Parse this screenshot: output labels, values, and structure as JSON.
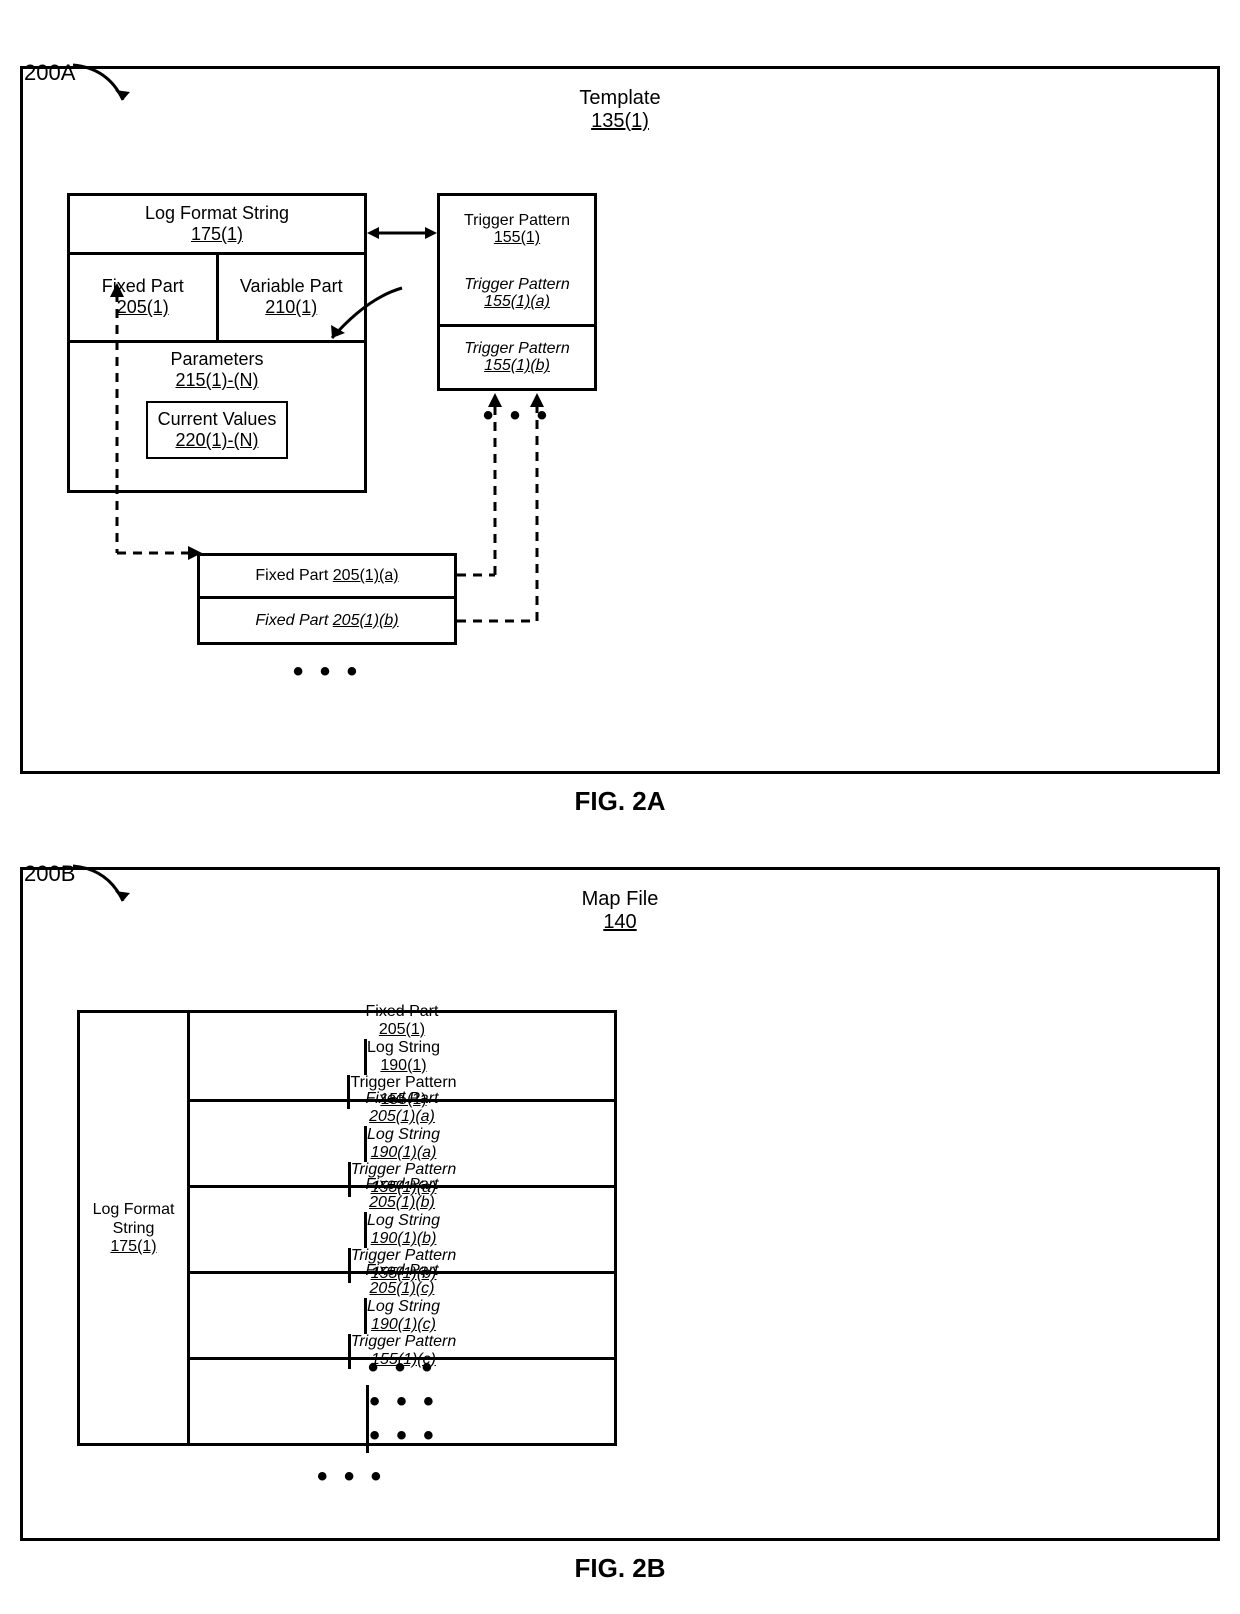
{
  "fig2a": {
    "ref": "200A",
    "label": "FIG. 2A",
    "template_title": "Template",
    "template_ref": "135(1)",
    "lfs_title": "Log Format String",
    "lfs_ref": "175(1)",
    "fixed_part": "Fixed Part",
    "fixed_part_ref": "205(1)",
    "variable_part": "Variable Part",
    "variable_part_ref": "210(1)",
    "parameters": "Parameters",
    "parameters_ref": "215(1)-(N)",
    "current_values": "Current Values",
    "current_values_ref": "220(1)-(N)",
    "tp_title": "Trigger Pattern",
    "tp_ref": "155(1)",
    "tp_a": "Trigger Pattern",
    "tp_a_ref": "155(1)(a)",
    "tp_b": "Trigger Pattern",
    "tp_b_ref": "155(1)(b)",
    "fx_a": "Fixed Part",
    "fx_a_ref": "205(1)(a)",
    "fx_b": "Fixed Part",
    "fx_b_ref": "205(1)(b)"
  },
  "fig2b": {
    "ref": "200B",
    "label": "FIG. 2B",
    "mapfile_title": "Map File",
    "mapfile_ref": "140",
    "lfs_col": "Log Format String",
    "lfs_col_ref": "175(1)",
    "headers": {
      "fixed": "Fixed Part",
      "fixed_ref": "205(1)",
      "log": "Log String",
      "log_ref": "190(1)",
      "tp": "Trigger Pattern",
      "tp_ref": "155(1)"
    },
    "rows": [
      {
        "fixed": "Fixed Part",
        "fixed_ref": "205(1)(a)",
        "log": "Log String",
        "log_ref": "190(1)(a)",
        "tp": "Trigger Pattern",
        "tp_ref": "155(1)(a)"
      },
      {
        "fixed": "Fixed Part",
        "fixed_ref": "205(1)(b)",
        "log": "Log String",
        "log_ref": "190(1)(b)",
        "tp": "Trigger Pattern",
        "tp_ref": "155(1)(b)"
      },
      {
        "fixed": "Fixed Part",
        "fixed_ref": "205(1)(c)",
        "log": "Log String",
        "log_ref": "190(1)(c)",
        "tp": "Trigger Pattern",
        "tp_ref": "155(1)(c)"
      }
    ]
  }
}
